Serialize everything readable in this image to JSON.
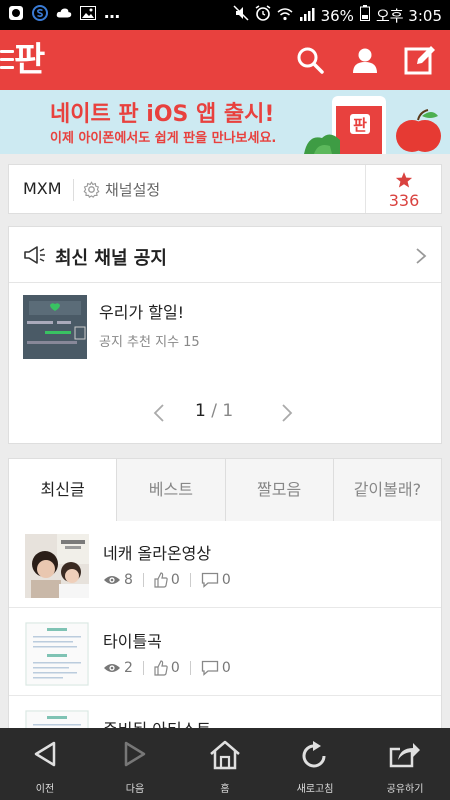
{
  "status_bar": {
    "battery": "36%",
    "time": "오후 3:05"
  },
  "header": {
    "logo": "판"
  },
  "banner": {
    "title": "네이트 판 iOS 앱 출시!",
    "subtitle": "이제 아이폰에서도 쉽게 판을 만나보세요.",
    "art_label": "판"
  },
  "channel": {
    "name": "MXM",
    "settings_label": "채널설정",
    "star_count": "336"
  },
  "notice": {
    "title": "최신 채널 공지",
    "item": {
      "title": "우리가 할일!",
      "meta": "공지 추천 지수 15"
    },
    "pager": {
      "current": "1",
      "separator": "/",
      "total": "1"
    }
  },
  "feed": {
    "tabs": [
      {
        "label": "최신글"
      },
      {
        "label": "베스트"
      },
      {
        "label": "짤모음"
      },
      {
        "label": "같이볼래?"
      }
    ],
    "posts": [
      {
        "title": "네캐 올라온영상",
        "views": "8",
        "likes": "0",
        "comments": "0"
      },
      {
        "title": "타이틀곡",
        "views": "2",
        "likes": "0",
        "comments": "0"
      },
      {
        "title": "준비된 아티스트"
      }
    ]
  },
  "bottom_nav": [
    {
      "label": "이전",
      "icon": "back-icon"
    },
    {
      "label": "다음",
      "icon": "forward-icon"
    },
    {
      "label": "홈",
      "icon": "home-icon"
    },
    {
      "label": "새로고침",
      "icon": "refresh-icon"
    },
    {
      "label": "공유하기",
      "icon": "share-icon"
    }
  ],
  "colors": {
    "brand": "#e8413e",
    "banner_bg": "#cdeaf2",
    "nav_bg": "#2b2b2b"
  }
}
